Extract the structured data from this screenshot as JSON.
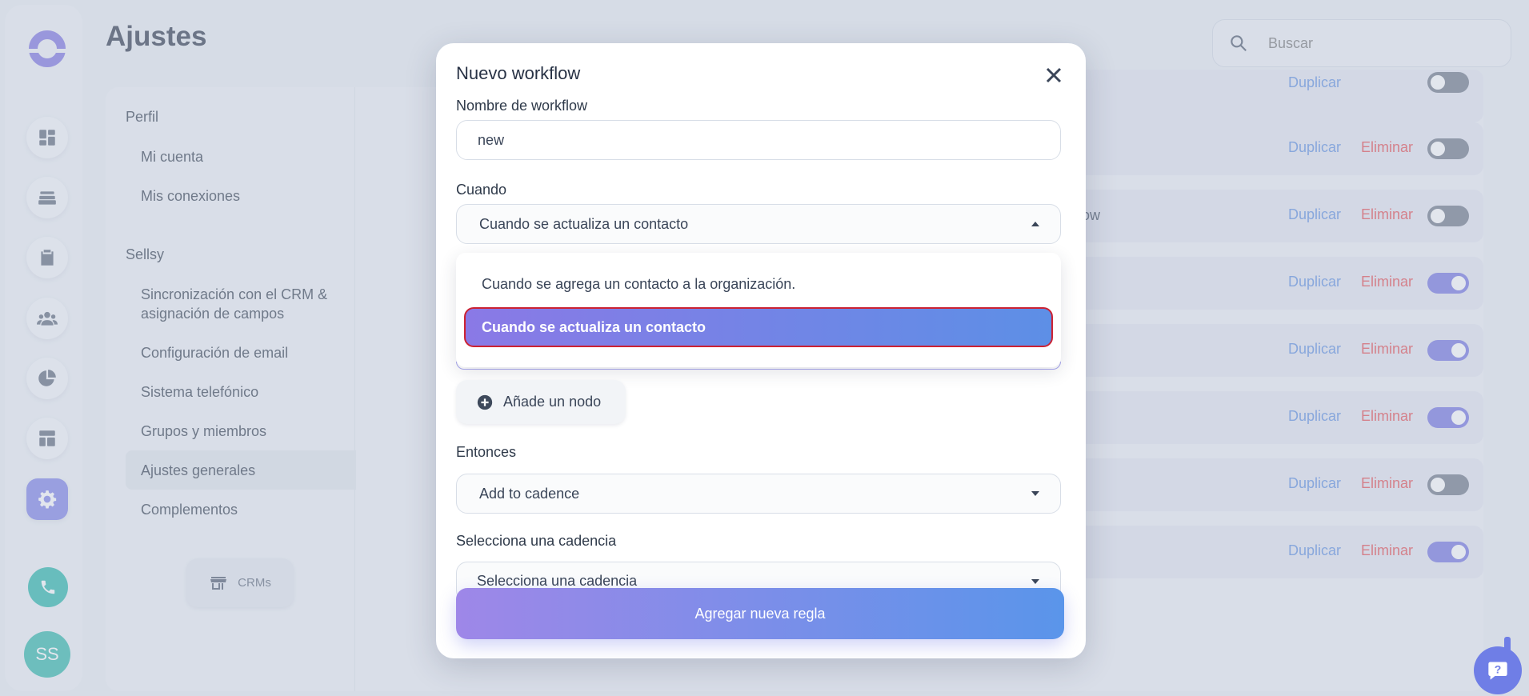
{
  "app": {
    "page_title": "Ajustes",
    "avatar_initials": "SS"
  },
  "search": {
    "placeholder": "Buscar",
    "icon": "search-icon"
  },
  "rail": {
    "items": [
      {
        "icon": "dashboard-icon"
      },
      {
        "icon": "inbox-icon"
      },
      {
        "icon": "clipboard-icon"
      },
      {
        "icon": "people-icon"
      },
      {
        "icon": "pie-chart-icon"
      },
      {
        "icon": "layout-icon"
      },
      {
        "icon": "gear-icon",
        "active": true
      }
    ],
    "phone_icon": "phone-icon",
    "accent": "#7b7fe8"
  },
  "settings_nav": {
    "sections": [
      {
        "title": "Perfil",
        "items": [
          "Mi cuenta",
          "Mis conexiones"
        ]
      },
      {
        "title": "Sellsy",
        "items": [
          "Sincronización con el CRM &",
          "asignación de campos",
          "Configuración de email",
          "Sistema telefónico",
          "Grupos y miembros",
          "Ajustes generales",
          "Complementos"
        ]
      }
    ],
    "active_item": "Ajustes generales",
    "crm_button": "CRMs"
  },
  "workflow_rows": [
    {
      "tail": "",
      "duplicate": "Duplicar",
      "delete": "Eliminar",
      "enabled": false
    },
    {
      "tail": "ow",
      "duplicate": "Duplicar",
      "delete": "Eliminar",
      "enabled": false
    },
    {
      "tail": "",
      "duplicate": "Duplicar",
      "delete": "Eliminar",
      "enabled": true
    },
    {
      "tail": "",
      "duplicate": "Duplicar",
      "delete": "Eliminar",
      "enabled": true
    },
    {
      "tail": "",
      "duplicate": "Duplicar",
      "delete": "Eliminar",
      "enabled": true
    },
    {
      "tail": "",
      "duplicate": "Duplicar",
      "delete": "Eliminar",
      "enabled": false
    },
    {
      "tail": "",
      "duplicate": "Duplicar",
      "delete": "Eliminar",
      "enabled": true
    }
  ],
  "modal": {
    "title": "Nuevo workflow",
    "name_label": "Nombre de workflow",
    "name_value": "new",
    "when_label": "Cuando",
    "when_value": "Cuando se actualiza un contacto",
    "when_options": [
      "Cuando se agrega un contacto a la organización.",
      "Cuando se actualiza un contacto"
    ],
    "add_node": "Añade un nodo",
    "then_label": "Entonces",
    "then_value": "Add to cadence",
    "cadence_label": "Selecciona una cadencia",
    "cadence_value": "Selecciona una cadencia",
    "submit": "Agregar nueva regla"
  },
  "colors": {
    "duplicate": "#5b8de0",
    "delete": "#e5484d",
    "toggle_on": "#6f6fe0",
    "toggle_off": "#6b7384"
  }
}
